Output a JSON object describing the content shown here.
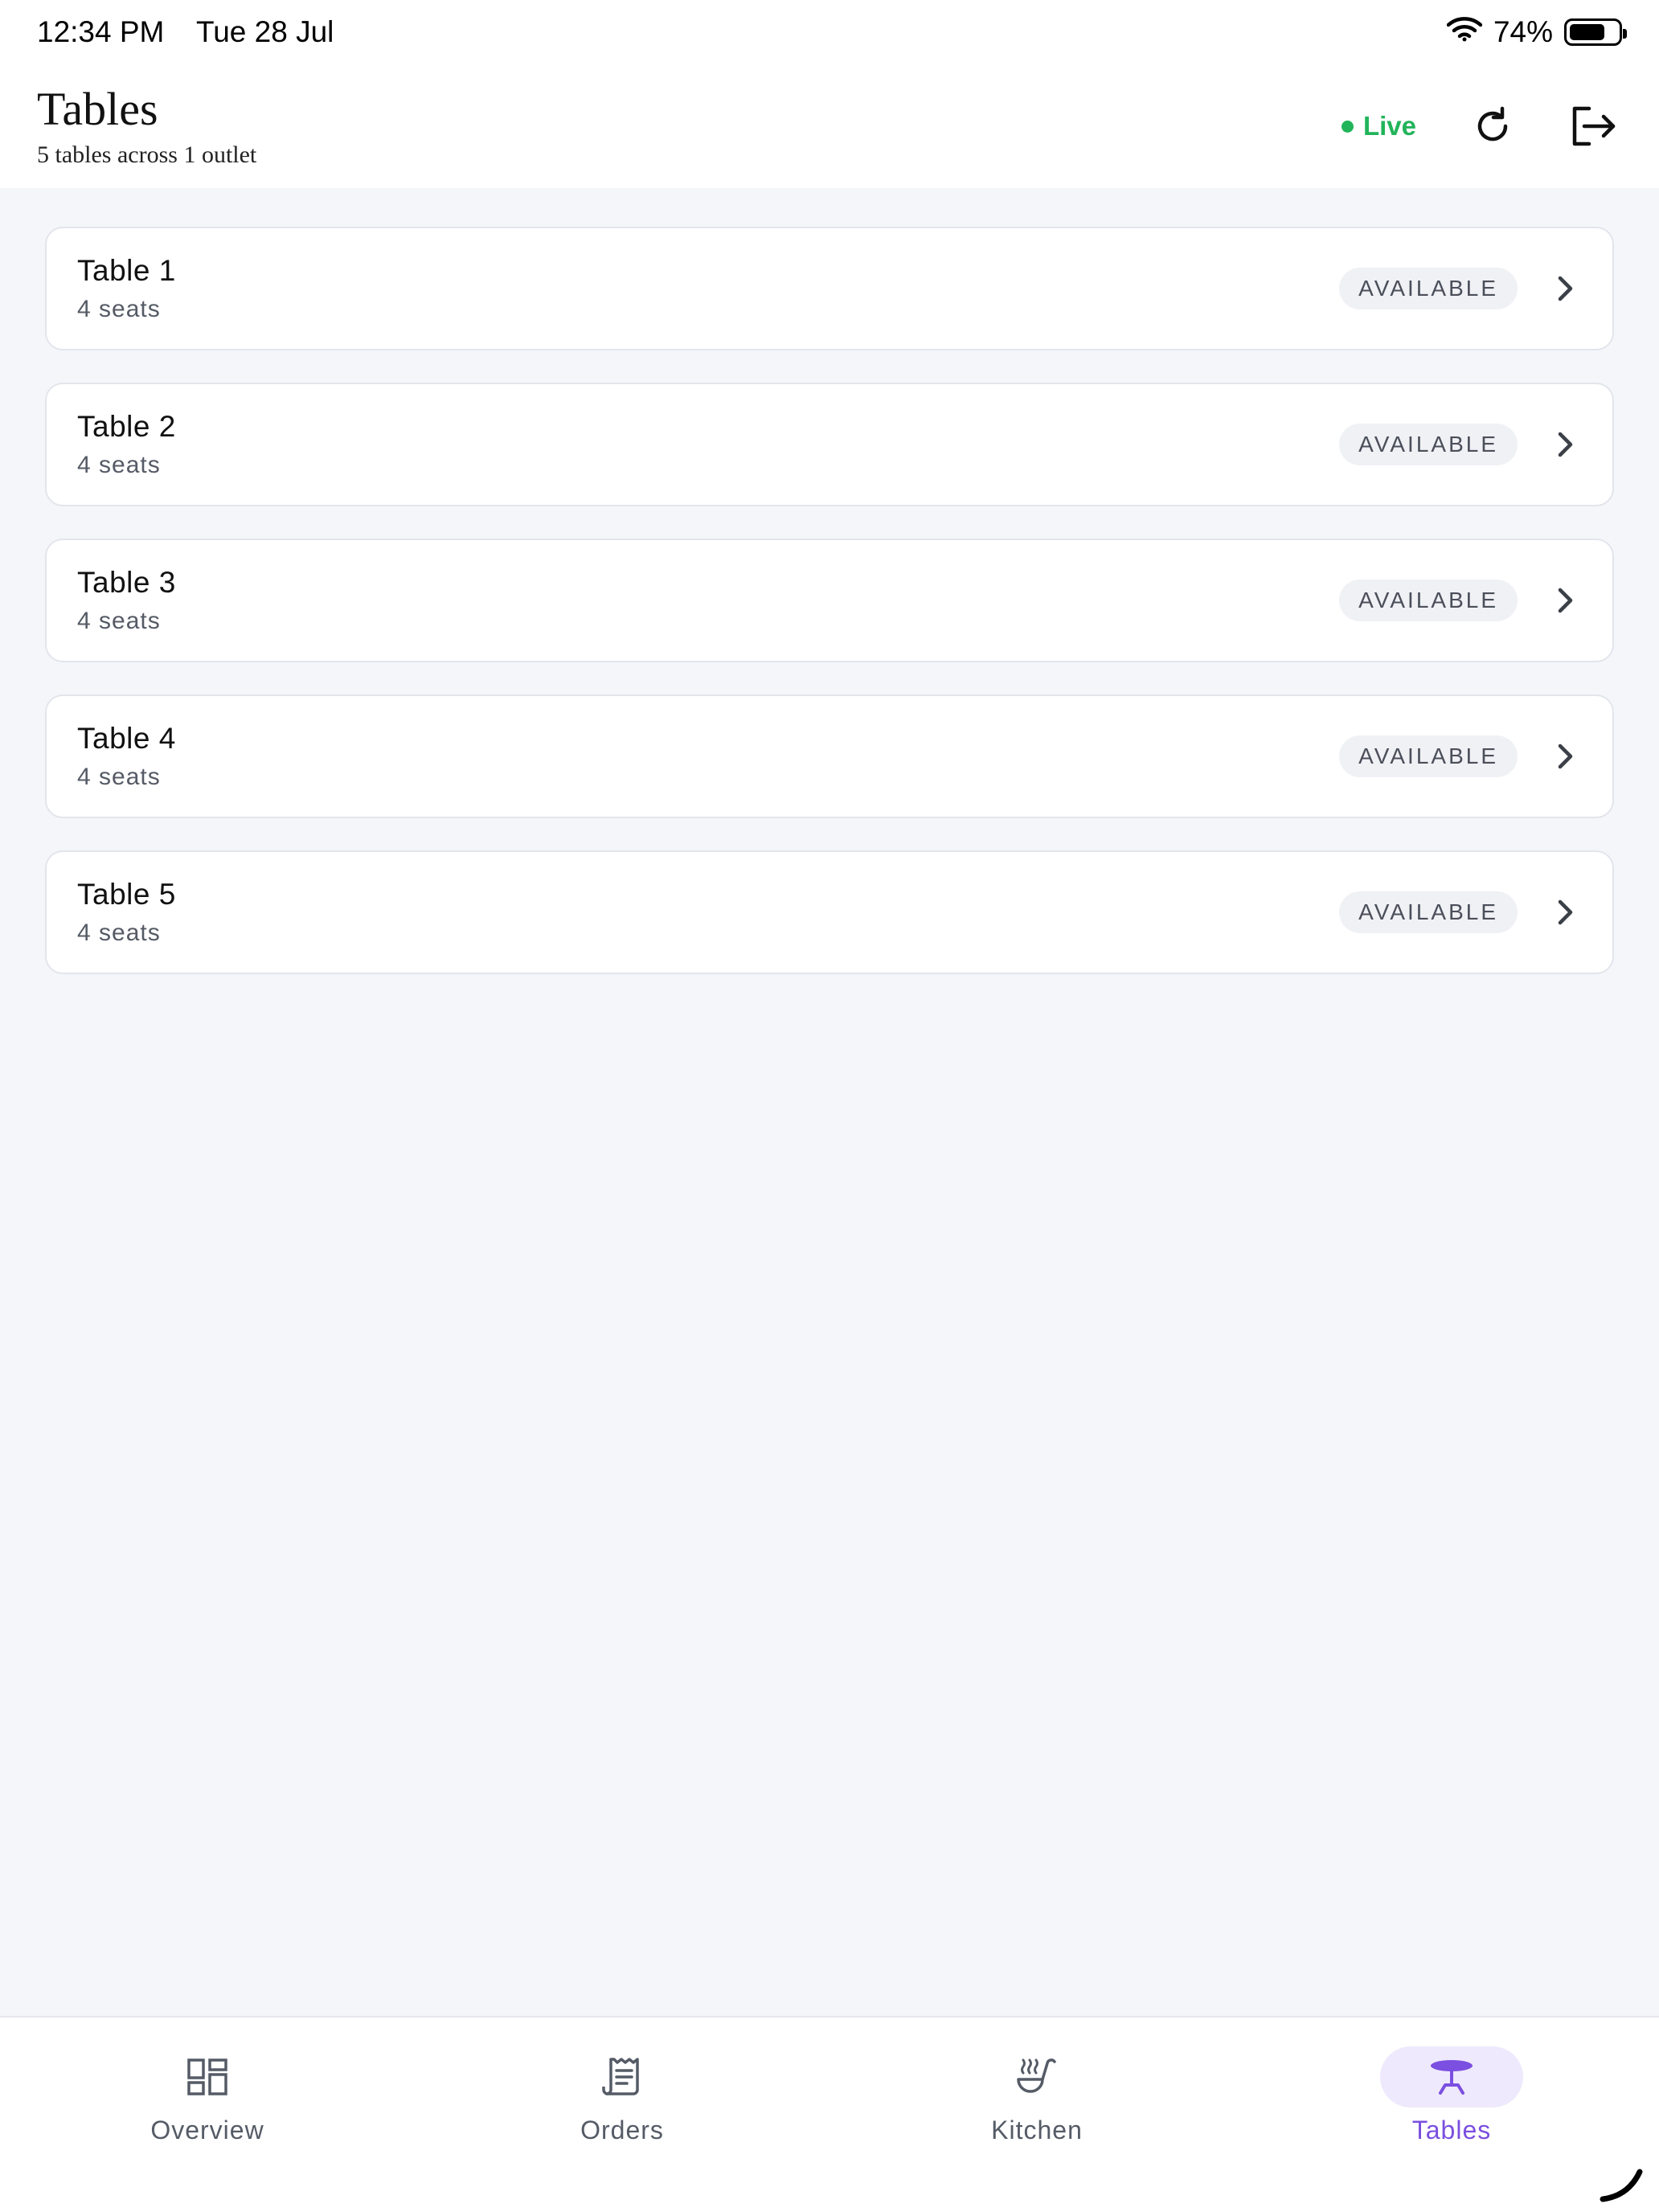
{
  "status_bar": {
    "time": "12:34 PM",
    "date": "Tue 28 Jul",
    "battery": "74%",
    "battery_level": 0.74,
    "wifi_icon": "wifi-icon"
  },
  "header": {
    "title": "Tables",
    "subtitle": "5 tables across 1 outlet",
    "live_label": "Live",
    "refresh_icon": "refresh-icon",
    "logout_icon": "logout-icon"
  },
  "tables": [
    {
      "name": "Table 1",
      "seats": "4 seats",
      "status": "AVAILABLE"
    },
    {
      "name": "Table 2",
      "seats": "4 seats",
      "status": "AVAILABLE"
    },
    {
      "name": "Table 3",
      "seats": "4 seats",
      "status": "AVAILABLE"
    },
    {
      "name": "Table 4",
      "seats": "4 seats",
      "status": "AVAILABLE"
    },
    {
      "name": "Table 5",
      "seats": "4 seats",
      "status": "AVAILABLE"
    }
  ],
  "nav": [
    {
      "label": "Overview",
      "icon": "dashboard-icon"
    },
    {
      "label": "Orders",
      "icon": "receipt-icon"
    },
    {
      "label": "Kitchen",
      "icon": "cooking-pot-icon"
    },
    {
      "label": "Tables",
      "icon": "table-icon",
      "active": true
    }
  ],
  "colors": {
    "accent": "#7b4fe0",
    "live": "#22b45a",
    "background": "#f5f6fa"
  }
}
